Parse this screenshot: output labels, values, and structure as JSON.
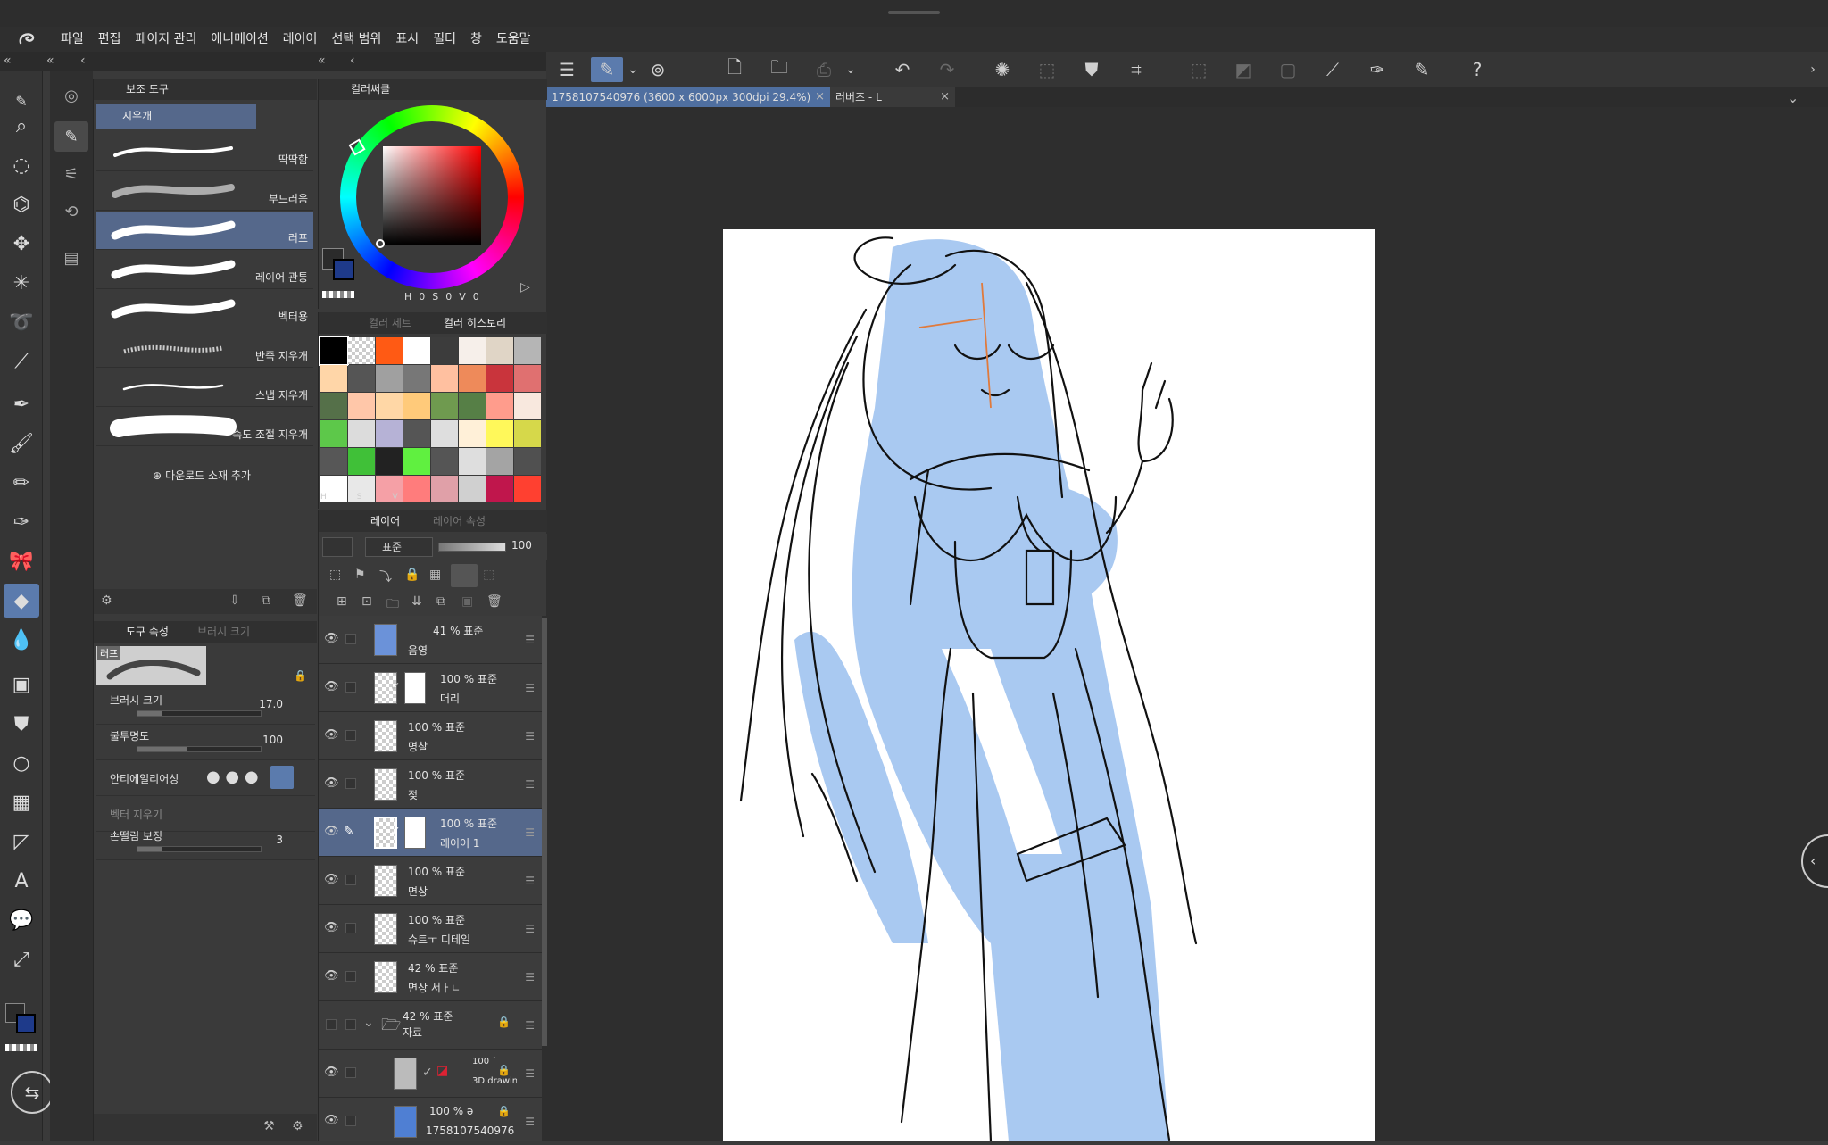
{
  "menu": [
    "파일",
    "편집",
    "페이지 관리",
    "애니메이션",
    "레이어",
    "선택 범위",
    "표시",
    "필터",
    "창",
    "도움말"
  ],
  "document_tabs": [
    {
      "label": "1758107540976 (3600 x 6000px 300dpi 29.4%)",
      "close": "×"
    },
    {
      "label": "러버즈 - L",
      "close": "×"
    }
  ],
  "subtool_panel": {
    "title": "보조 도구",
    "group": "지우개",
    "items": [
      {
        "label": "딱딱함"
      },
      {
        "label": "부드러움"
      },
      {
        "label": "러프",
        "selected": true
      },
      {
        "label": "레이어 관통"
      },
      {
        "label": "벡터용"
      },
      {
        "label": "반죽 지우개"
      },
      {
        "label": "스냅 지우개"
      },
      {
        "label": "속도 조절 지우개"
      }
    ],
    "add_material": "다운로드 소재 추가"
  },
  "tool_property": {
    "tab_active": "도구 속성",
    "tab_inactive": "브러시 크기",
    "preset_name": "러프",
    "brush_size": {
      "label": "브러시 크기",
      "value": "17.0",
      "fill": 0.2
    },
    "opacity": {
      "label": "불투명도",
      "value": "100",
      "fill": 0.4
    },
    "antialias": {
      "label": "안티에일리어싱"
    },
    "vector_erase": {
      "label": "벡터 지우기"
    },
    "stabilization": {
      "label": "손떨림 보정",
      "value": "3",
      "fill": 0.2
    }
  },
  "color_wheel": {
    "title": "컬러써클",
    "hsv_labels": [
      "H",
      "0",
      "S",
      "0",
      "V",
      "0"
    ],
    "colors": {
      "main": "#2b2b2b",
      "sub": "#1e3a8a"
    }
  },
  "color_history": {
    "tab_inactive": "컬러 세트",
    "tab_active": "컬러 히스토리",
    "footer": [
      "H",
      "S",
      "V"
    ],
    "swatches": [
      "#000000",
      "checker",
      "#ff5a14",
      "#ffffff",
      "#3c3c3c",
      "#f6efea",
      "#e0d5c6",
      "#b5b5b5",
      "#ffd6a8",
      "#555555",
      "#a0a0a0",
      "#777777",
      "#ffc0a0",
      "#ee8a5a",
      "#c9343c",
      "#e07070",
      "#557049",
      "#ffc7a9",
      "#ffd7a6",
      "#ffca7a",
      "#6f9a4f",
      "#567f46",
      "#ff9c8c",
      "#f8e8de",
      "#5dc84a",
      "#dcdcdc",
      "#b6b2d6",
      "#555555",
      "#dedede",
      "#fff0d8",
      "#fff85a",
      "#d6d84a",
      "#575757",
      "#40c038",
      "#222222",
      "#60f040",
      "#555555",
      "#dedede",
      "#a4a4a4",
      "#505050",
      "#ffffff",
      "#e8e8e8",
      "#f5a0a6",
      "#ff7c7c",
      "#e0a0a8",
      "#d0d0d0",
      "#c0164c",
      "#ff4030"
    ]
  },
  "layer_panel": {
    "tab_active": "레이어",
    "tab_inactive": "레이어 속성",
    "blend": "표준",
    "opacity": "100",
    "layers": [
      {
        "mode": "41 % 표준",
        "name": "음영"
      },
      {
        "mode": "100 % 표준",
        "name": "머리",
        "mask": true
      },
      {
        "mode": "100 % 표준",
        "name": "명찰"
      },
      {
        "mode": "100 % 표준",
        "name": "젖"
      },
      {
        "mode": "100 % 표준",
        "name": "레이어 1",
        "mask": true,
        "selected": true
      },
      {
        "mode": "100 % 표준",
        "name": "면상"
      },
      {
        "mode": "100 % 표준",
        "name": "슈트ㅜ 디테일"
      },
      {
        "mode": "42 % 표준",
        "name": "면상 서ㅏㄴ"
      },
      {
        "mode": "42 % 표준",
        "name": "자료",
        "folder": true
      },
      {
        "mode": "100 ˆ",
        "name": "3D drawin"
      },
      {
        "mode": "100 % ǝ",
        "name": "1758107540976"
      }
    ]
  }
}
